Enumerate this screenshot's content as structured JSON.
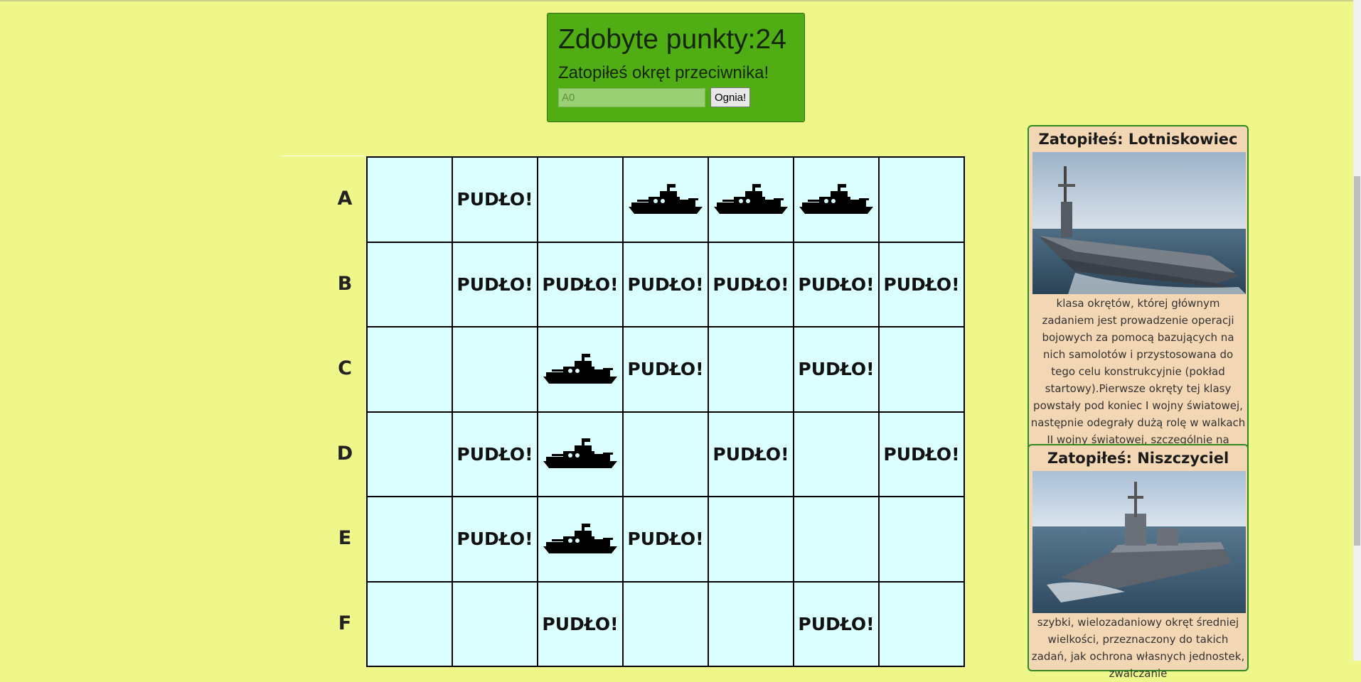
{
  "score": {
    "label": "Zdobyte punkty:",
    "value": "24"
  },
  "message": "Zatopiłeś okręt przeciwnika!",
  "fire_input": {
    "value": "",
    "placeholder": "A0"
  },
  "fire_button_label": "Ognia!",
  "miss_label": "PUDŁO!",
  "board": {
    "rows": [
      {
        "label": "A",
        "cells": [
          "",
          "miss",
          "",
          "ship",
          "ship",
          "ship",
          ""
        ]
      },
      {
        "label": "B",
        "cells": [
          "",
          "miss",
          "miss",
          "miss",
          "miss",
          "miss",
          "miss"
        ]
      },
      {
        "label": "C",
        "cells": [
          "",
          "",
          "ship",
          "miss",
          "",
          "miss",
          ""
        ]
      },
      {
        "label": "D",
        "cells": [
          "",
          "miss",
          "ship",
          "",
          "miss",
          "",
          "miss"
        ]
      },
      {
        "label": "E",
        "cells": [
          "",
          "miss",
          "ship",
          "miss",
          "",
          "",
          ""
        ]
      },
      {
        "label": "F",
        "cells": [
          "",
          "",
          "miss",
          "",
          "",
          "miss",
          ""
        ]
      }
    ]
  },
  "cards": [
    {
      "title": "Zatopiłeś: Lotniskowiec",
      "image": "aircraft-carrier-photo",
      "description": "klasa okrętów, której głównym zadaniem jest prowadzenie operacji bojowych za pomocą bazujących na nich samolotów i przystosowana do tego celu konstrukcyjnie (pokład startowy).Pierwsze okręty tej klasy powstały pod koniec I wojny światowej, następnie odegrały dużą rolę w walkach II wojny światowej, szczególnie na Pacyfiku."
    },
    {
      "title": "Zatopiłeś: Niszczyciel",
      "image": "destroyer-photo",
      "description": "szybki, wielozadaniowy okręt średniej wielkości, przeznaczony do takich zadań, jak ochrona własnych jednostek, zwalczanie"
    }
  ],
  "colors": {
    "page_bg": "#f0f78a",
    "panel_bg": "#50ae14",
    "cell_bg": "#dafffe",
    "card_bg": "#f3d6b4",
    "card_border": "#2e8a1c"
  }
}
